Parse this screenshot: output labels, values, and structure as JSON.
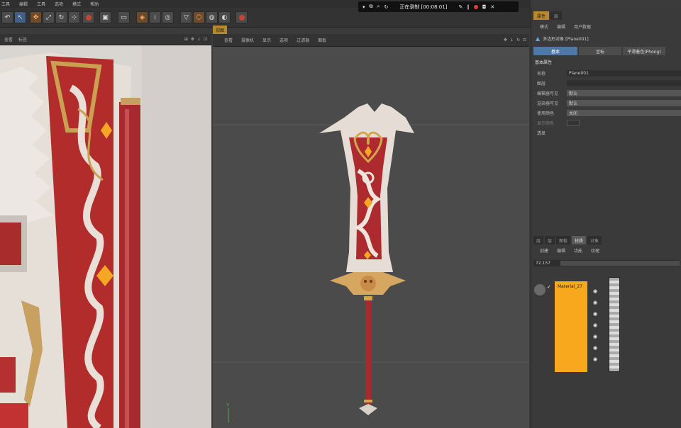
{
  "menubar": {
    "items": [
      "工具",
      "编辑",
      "工具",
      "选项",
      "模式",
      "帮助"
    ]
  },
  "recording": {
    "label": "正在录制 [00:08:01]"
  },
  "uv_panel": {
    "tabs": [
      "查看",
      "标签"
    ]
  },
  "viewport": {
    "tab_label": "视图",
    "menu": [
      "查看",
      "摄像机",
      "显示",
      "选项",
      "过滤器",
      "面板"
    ],
    "axis_label": "Y"
  },
  "attributes": {
    "tabs": [
      "属性",
      "层"
    ],
    "menu": [
      "模式",
      "编辑",
      "用户数据"
    ],
    "object_title": "多边形对象 [Plane001]",
    "mode_tabs": [
      "基本",
      "坐标",
      "平滑着色(Phong)"
    ],
    "section_title": "基本属性",
    "properties": [
      {
        "label": "名称",
        "value": "Plane001"
      },
      {
        "label": "图层",
        "value": ""
      },
      {
        "label": "编辑器可见",
        "value": "默认"
      },
      {
        "label": "渲染器可见",
        "value": "默认"
      },
      {
        "label": "使用颜色",
        "value": "关闭"
      },
      {
        "label": "显示颜色",
        "value": ""
      },
      {
        "label": "透显",
        "value": ""
      }
    ]
  },
  "layers": {
    "tabs": [
      "层",
      "层",
      "面板",
      "材质",
      "对象"
    ],
    "menu": [
      "创建",
      "编辑",
      "功能",
      "纹理"
    ],
    "slider_value": "72.157",
    "material_name": "Material_27"
  },
  "colors": {
    "accent": "#b98a2c",
    "material": "#f7a81c",
    "selected": "#4e78a8"
  }
}
